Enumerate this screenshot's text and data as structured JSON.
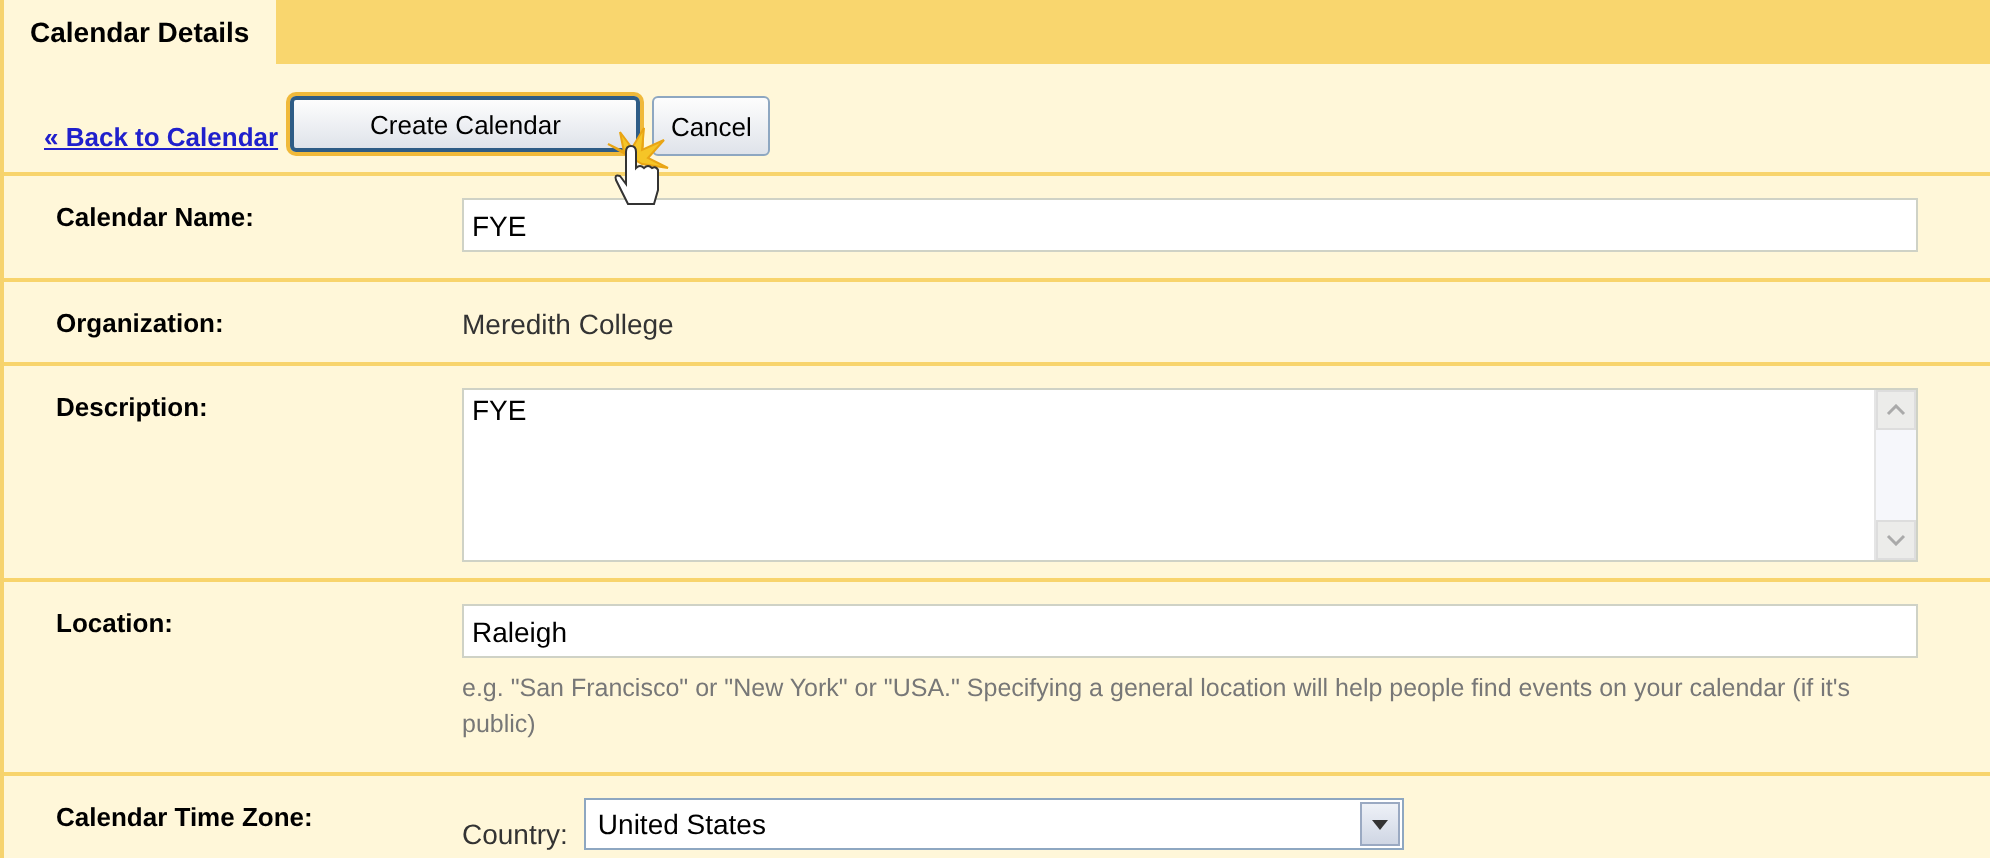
{
  "header": {
    "title": "Calendar Details"
  },
  "toolbar": {
    "back_link": "« Back to Calendar",
    "buttons": [
      "Create Calendar",
      "Cancel"
    ]
  },
  "rows": [
    {
      "kind": "input",
      "label": "Calendar Name:",
      "value": "FYE"
    },
    {
      "kind": "text",
      "label": "Organization:",
      "value": "Meredith College"
    },
    {
      "kind": "textarea",
      "label": "Description:",
      "value": "FYE"
    },
    {
      "kind": "input",
      "label": "Location:",
      "value": "Raleigh",
      "hint": "e.g. \"San Francisco\" or \"New York\" or \"USA.\" Specifying a general location will help people find events on your calendar (if it's public)"
    },
    {
      "kind": "select",
      "label": "Calendar Time Zone:",
      "field_label": "Country:",
      "value": "United States"
    }
  ]
}
